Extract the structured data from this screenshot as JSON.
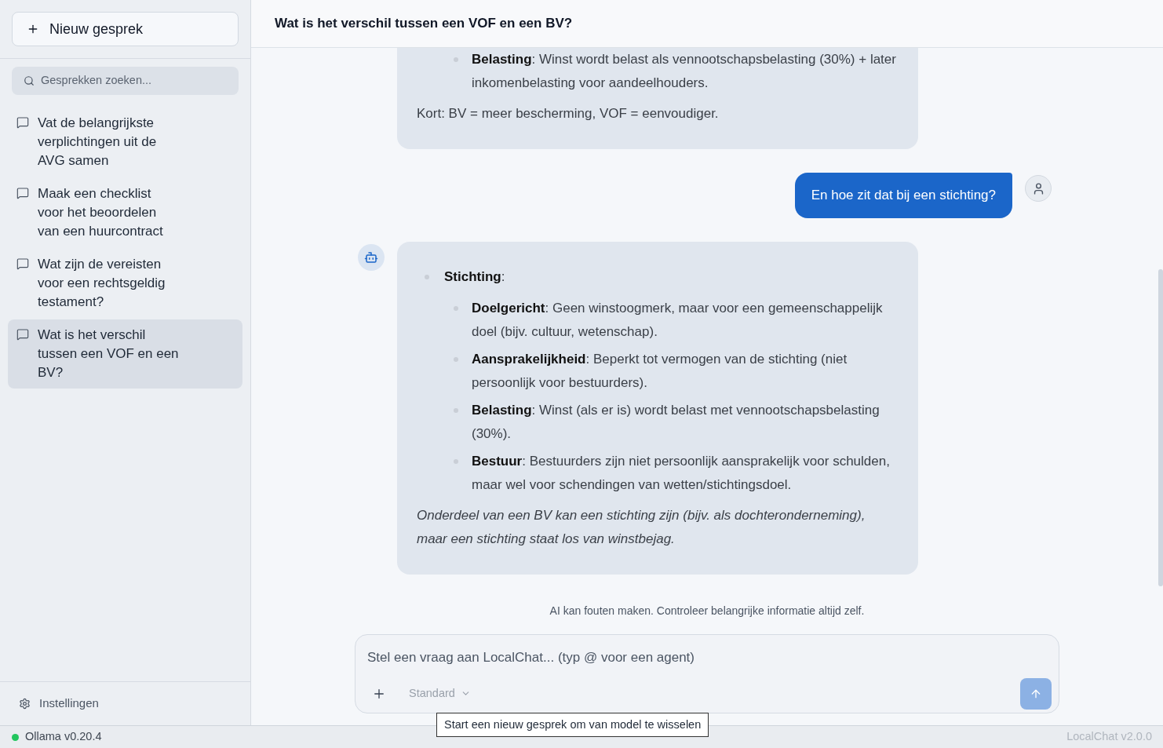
{
  "sidebar": {
    "new_chat_button": {
      "label": "Nieuw gesprek"
    },
    "search": {
      "placeholder": "Gesprekken zoeken..."
    },
    "conversations": [
      {
        "title": "Vat de belangrijkste verplichtingen uit de AVG samen",
        "selected": false
      },
      {
        "title": "Maak een checklist voor het beoordelen van een huurcontract",
        "selected": false
      },
      {
        "title": "Wat zijn de vereisten voor een rechtsgeldig testament?",
        "selected": false
      },
      {
        "title": "Wat is het verschil tussen een VOF en een BV?",
        "selected": true
      }
    ],
    "settings_button": {
      "label": "Instellingen"
    }
  },
  "chat": {
    "title": "Wat is het verschil tussen een VOF en een BV?",
    "messages": [
      {
        "kind": "assistant",
        "clipped": true,
        "blocks": [
          {
            "kind": "list",
            "items": [
              {
                "children": [
                  {
                    "text": "**Belasting**: Winst wordt belast als vennootschapsbelasting (30%) + later inkomenbelasting voor aandeelhouders."
                  }
                ]
              }
            ]
          },
          {
            "kind": "paragraph",
            "italic": false,
            "text": "Kort: BV = meer bescherming, VOF = eenvoudiger."
          }
        ]
      },
      {
        "kind": "user",
        "text": "En hoe zit dat bij een stichting?"
      },
      {
        "kind": "assistant",
        "clipped": false,
        "blocks": [
          {
            "kind": "list",
            "items": [
              {
                "text": "**Stichting**:",
                "children": [
                  {
                    "text": "**Doelgericht**: Geen winstoogmerk, maar voor een gemeenschappelijk doel (bijv. cultuur, wetenschap)."
                  },
                  {
                    "text": "**Aansprakelijkheid**: Beperkt tot vermogen van de stichting (niet persoonlijk voor bestuurders)."
                  },
                  {
                    "text": "**Belasting**: Winst (als er is) wordt belast met vennootschapsbelasting (30%)."
                  },
                  {
                    "text": "**Bestuur**: Bestuurders zijn niet persoonlijk aansprakelijk voor schulden, maar wel voor schendingen van wetten/stichtingsdoel."
                  }
                ]
              }
            ]
          },
          {
            "kind": "paragraph",
            "italic": true,
            "text": "Onderdeel van een BV kan een stichting zijn (bijv. als dochteronderneming), maar een stichting staat los van winstbejag."
          }
        ]
      }
    ]
  },
  "disclaimer": "AI kan fouten maken. Controleer belangrijke informatie altijd zelf.",
  "composer": {
    "placeholder": "Stel een vraag aan LocalChat... (typ @ voor een agent)",
    "model": "Standard",
    "send_button": {
      "disabled": true
    },
    "tooltip": "Start een nieuw gesprek om van model te wisselen"
  },
  "status_bar": {
    "connection": {
      "label": "Ollama v0.20.4",
      "online": true
    },
    "version": "LocalChat v2.0.0"
  }
}
